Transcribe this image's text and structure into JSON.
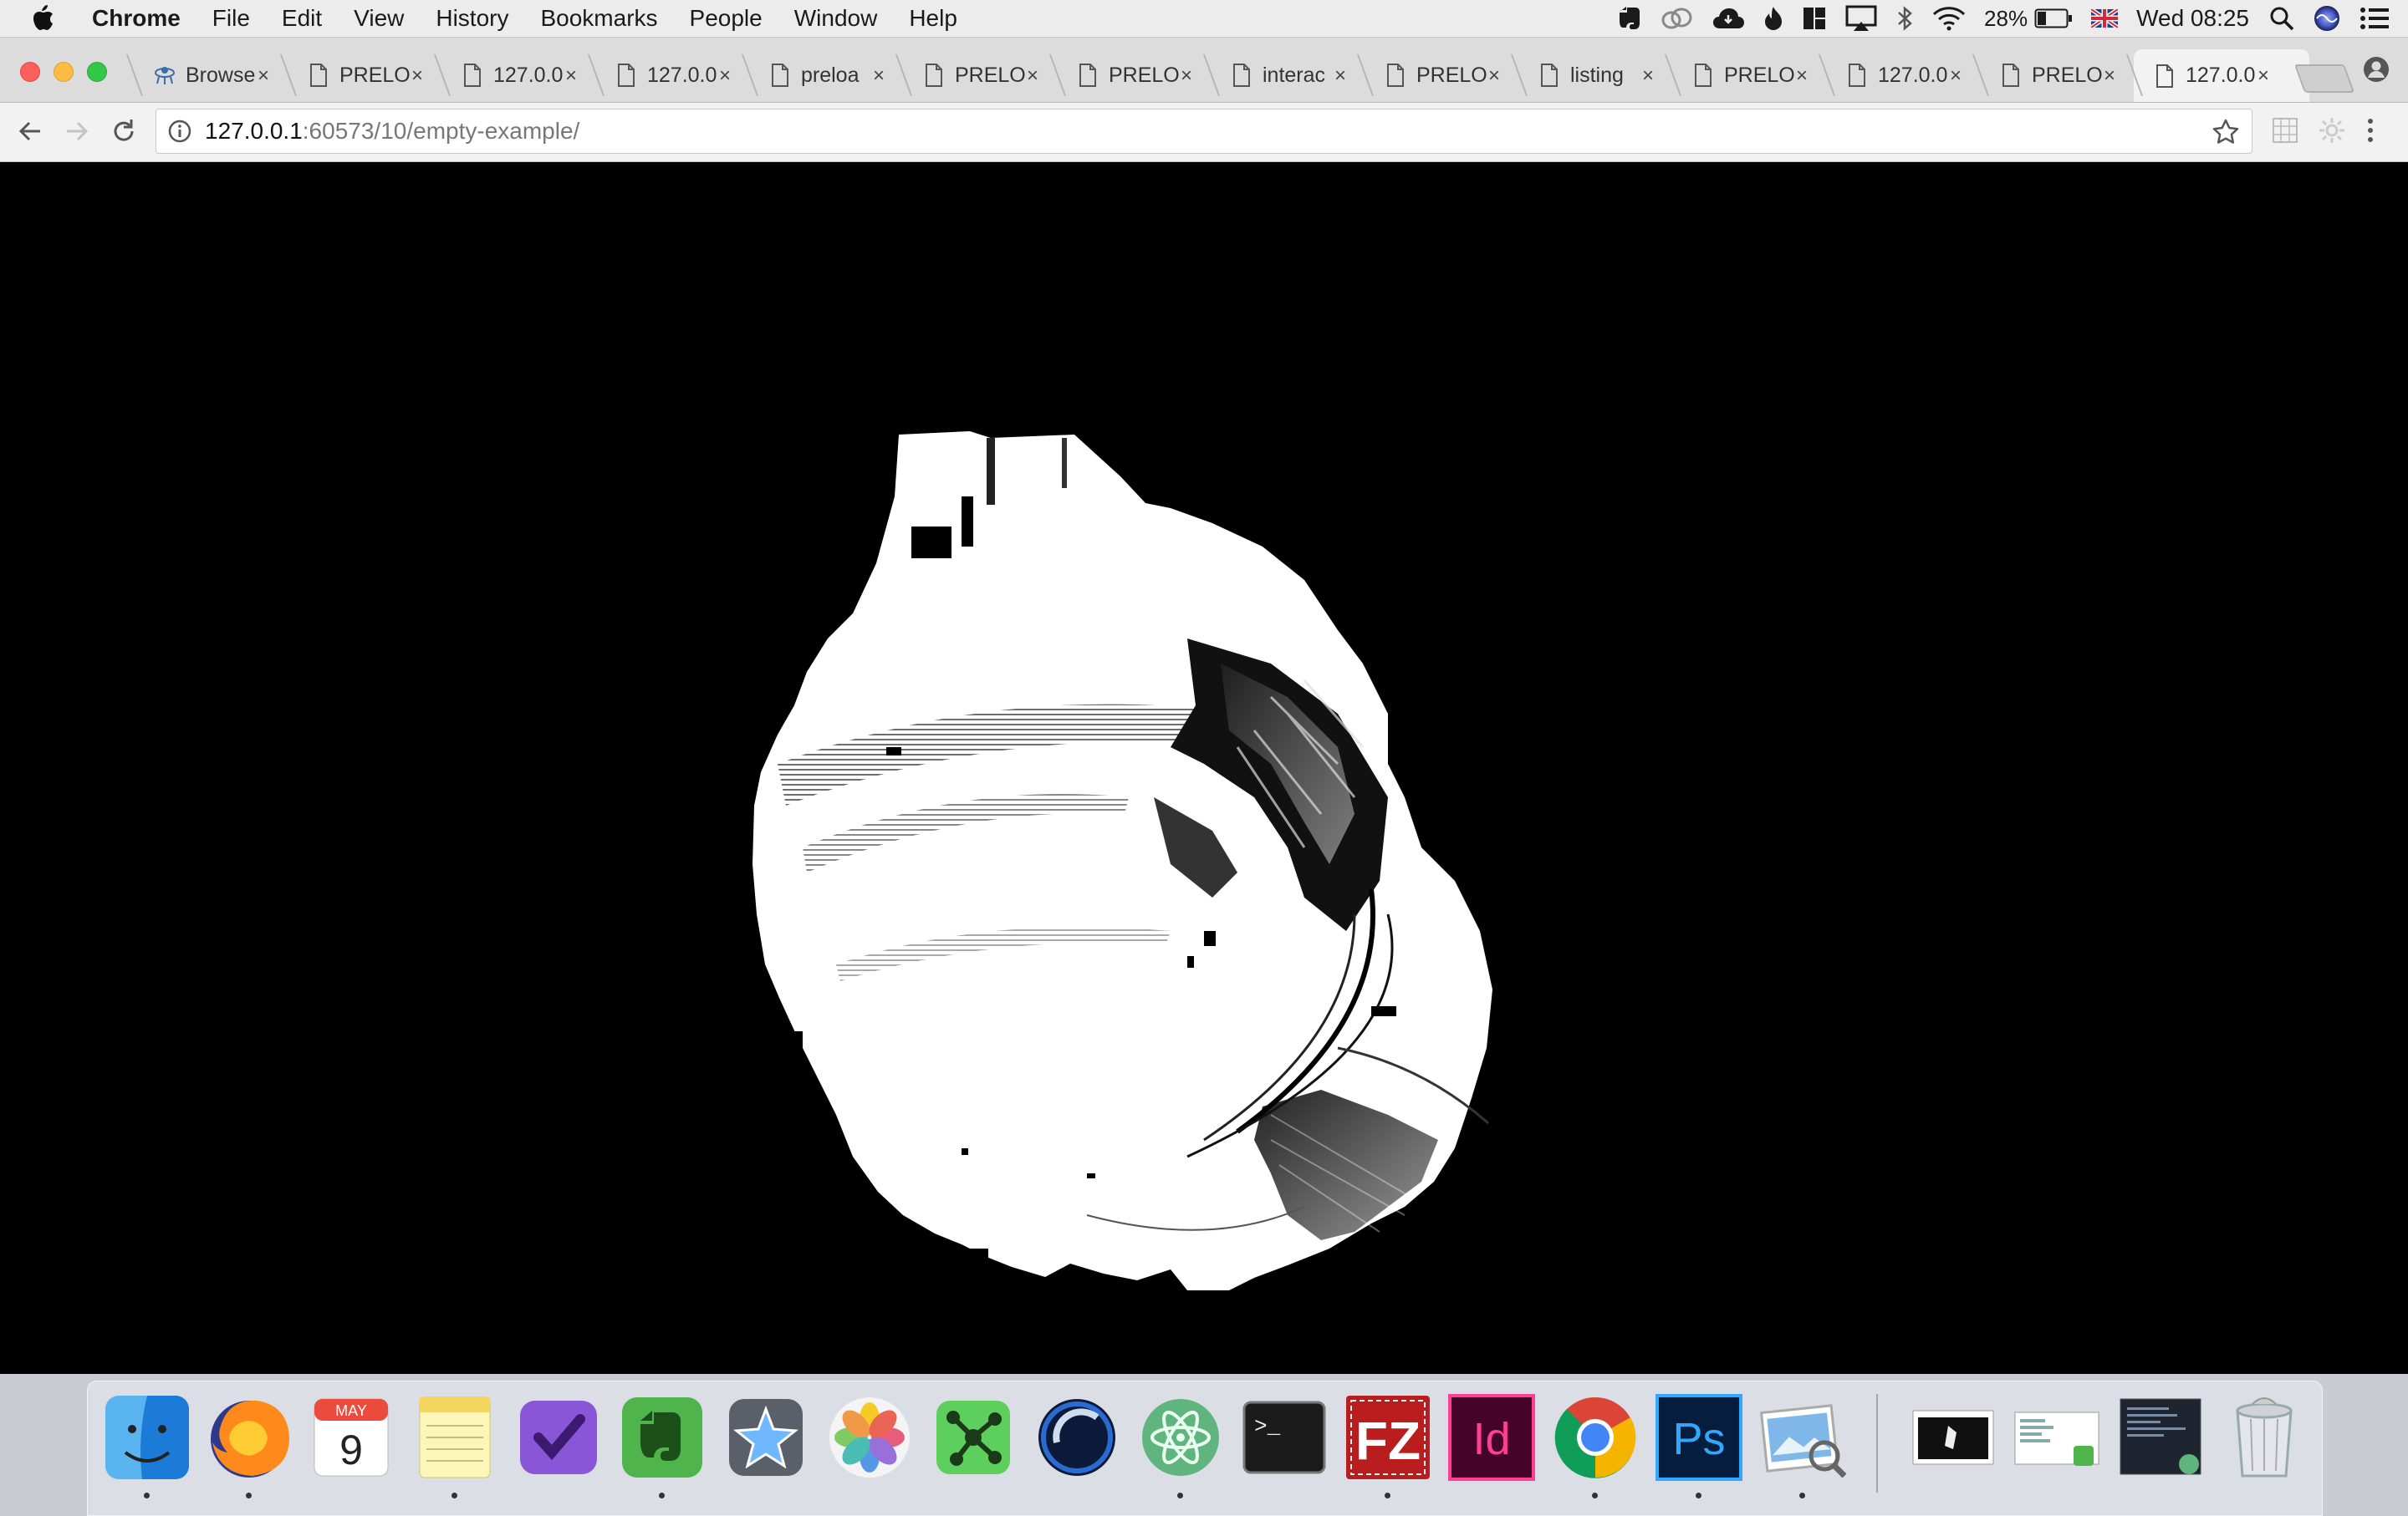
{
  "menubar": {
    "app_name": "Chrome",
    "menus": [
      "File",
      "Edit",
      "View",
      "History",
      "Bookmarks",
      "People",
      "Window",
      "Help"
    ],
    "status": {
      "battery_percent": "28%",
      "datetime": "Wed 08:25"
    },
    "icons": [
      "apple-icon",
      "evernote-icon",
      "creative-cloud-icon",
      "cloud-icon",
      "flame-icon",
      "window-layout-icon",
      "airplay-icon",
      "bluetooth-icon",
      "wifi-icon",
      "battery-icon",
      "uk-flag-icon",
      "spotlight-search-icon",
      "siri-icon",
      "notification-center-icon"
    ]
  },
  "tabs": [
    {
      "title": "Browse",
      "icon": "alien-favicon-icon",
      "active": false
    },
    {
      "title": "PRELO",
      "icon": "page-icon",
      "active": false
    },
    {
      "title": "127.0.0",
      "icon": "page-icon",
      "active": false
    },
    {
      "title": "127.0.0",
      "icon": "page-icon",
      "active": false
    },
    {
      "title": "preloa",
      "icon": "page-icon",
      "active": false
    },
    {
      "title": "PRELO",
      "icon": "page-icon",
      "active": false
    },
    {
      "title": "PRELO",
      "icon": "page-icon",
      "active": false
    },
    {
      "title": "interac",
      "icon": "page-icon",
      "active": false
    },
    {
      "title": "PRELO",
      "icon": "page-icon",
      "active": false
    },
    {
      "title": "listing",
      "icon": "page-icon",
      "active": false
    },
    {
      "title": "PRELO",
      "icon": "page-icon",
      "active": false
    },
    {
      "title": "127.0.0",
      "icon": "page-icon",
      "active": false
    },
    {
      "title": "PRELO",
      "icon": "page-icon",
      "active": false
    },
    {
      "title": "127.0.0",
      "icon": "page-icon",
      "active": true
    }
  ],
  "tab_close_glyph": "×",
  "toolbar": {
    "url_host": "127.0.0.1",
    "url_path": ":60573/10/empty-example/"
  },
  "dock": {
    "apps": [
      {
        "name": "finder-icon",
        "running": true
      },
      {
        "name": "firefox-icon",
        "running": true
      },
      {
        "name": "calendar-icon",
        "running": false,
        "month": "MAY",
        "day": "9"
      },
      {
        "name": "notes-icon",
        "running": true
      },
      {
        "name": "omnifocus-icon",
        "running": false
      },
      {
        "name": "evernote-icon",
        "running": true
      },
      {
        "name": "sparkle-app-icon",
        "running": false
      },
      {
        "name": "photos-icon",
        "running": false
      },
      {
        "name": "sourcetree-icon",
        "running": false
      },
      {
        "name": "cinema4d-icon",
        "running": false
      },
      {
        "name": "atom-icon",
        "running": true
      },
      {
        "name": "terminal-icon",
        "running": false,
        "prompt": ">_"
      },
      {
        "name": "filezilla-icon",
        "running": true,
        "label": "FZ"
      },
      {
        "name": "indesign-icon",
        "running": false,
        "label": "Id"
      },
      {
        "name": "chrome-icon",
        "running": true
      },
      {
        "name": "photoshop-icon",
        "running": true,
        "label": "Ps"
      },
      {
        "name": "preview-icon",
        "running": true
      },
      {
        "name": "minimized-window-1-icon",
        "running": false
      },
      {
        "name": "minimized-window-2-icon",
        "running": false
      },
      {
        "name": "minimized-window-3-icon",
        "running": false
      },
      {
        "name": "trash-icon",
        "running": false
      }
    ]
  },
  "colors": {
    "viewport_bg": "#000000",
    "close_red": "#fc605c",
    "minimize_yellow": "#fdbc40",
    "zoom_green": "#34c84a"
  }
}
